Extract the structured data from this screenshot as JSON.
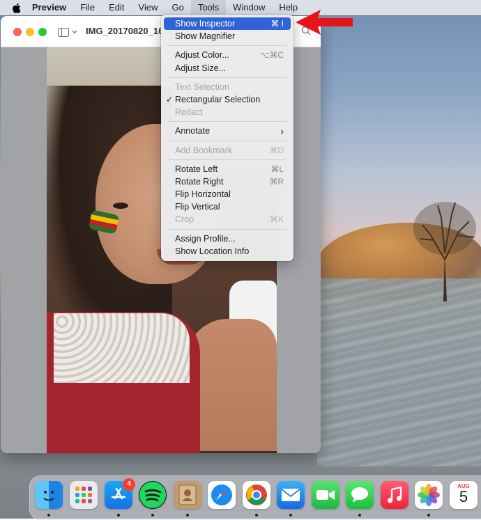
{
  "menubar": {
    "items": [
      "Preview",
      "File",
      "Edit",
      "View",
      "Go",
      "Tools",
      "Window",
      "Help"
    ],
    "active_item": "Tools"
  },
  "window": {
    "title": "IMG_20170820_16",
    "traffic_lights": {
      "close": "#fe5f57",
      "minimize": "#febc2e",
      "zoom": "#28c840"
    }
  },
  "tools_menu": {
    "show_inspector": {
      "label": "Show Inspector",
      "shortcut": "⌘ I"
    },
    "show_magnifier": {
      "label": "Show Magnifier"
    },
    "adjust_color": {
      "label": "Adjust Color...",
      "shortcut": "⌥⌘C"
    },
    "adjust_size": {
      "label": "Adjust Size..."
    },
    "text_selection": {
      "label": "Text Selection"
    },
    "rectangular_selection": {
      "label": "Rectangular Selection",
      "check": "✓"
    },
    "redact": {
      "label": "Redact"
    },
    "annotate": {
      "label": "Annotate",
      "chevron": "›"
    },
    "add_bookmark": {
      "label": "Add Bookmark",
      "shortcut": "⌘D"
    },
    "rotate_left": {
      "label": "Rotate Left",
      "shortcut": "⌘L"
    },
    "rotate_right": {
      "label": "Rotate Right",
      "shortcut": "⌘R"
    },
    "flip_horizontal": {
      "label": "Flip Horizontal"
    },
    "flip_vertical": {
      "label": "Flip Vertical"
    },
    "crop": {
      "label": "Crop",
      "shortcut": "⌘K"
    },
    "assign_profile": {
      "label": "Assign Profile..."
    },
    "show_location_info": {
      "label": "Show Location Info"
    }
  },
  "colors": {
    "menu_highlight": "#2f63d6",
    "annotation_arrow": "#e8141b"
  },
  "dock": {
    "app_store_badge": "4",
    "calendar_month": "AUG",
    "calendar_day": "5",
    "icons": [
      "finder-icon",
      "launchpad-icon",
      "app-store-icon",
      "spotify-icon",
      "contacts-icon",
      "safari-icon",
      "chrome-icon",
      "mail-icon",
      "facetime-icon",
      "messages-icon",
      "music-icon",
      "photos-icon",
      "calendar-icon"
    ]
  }
}
